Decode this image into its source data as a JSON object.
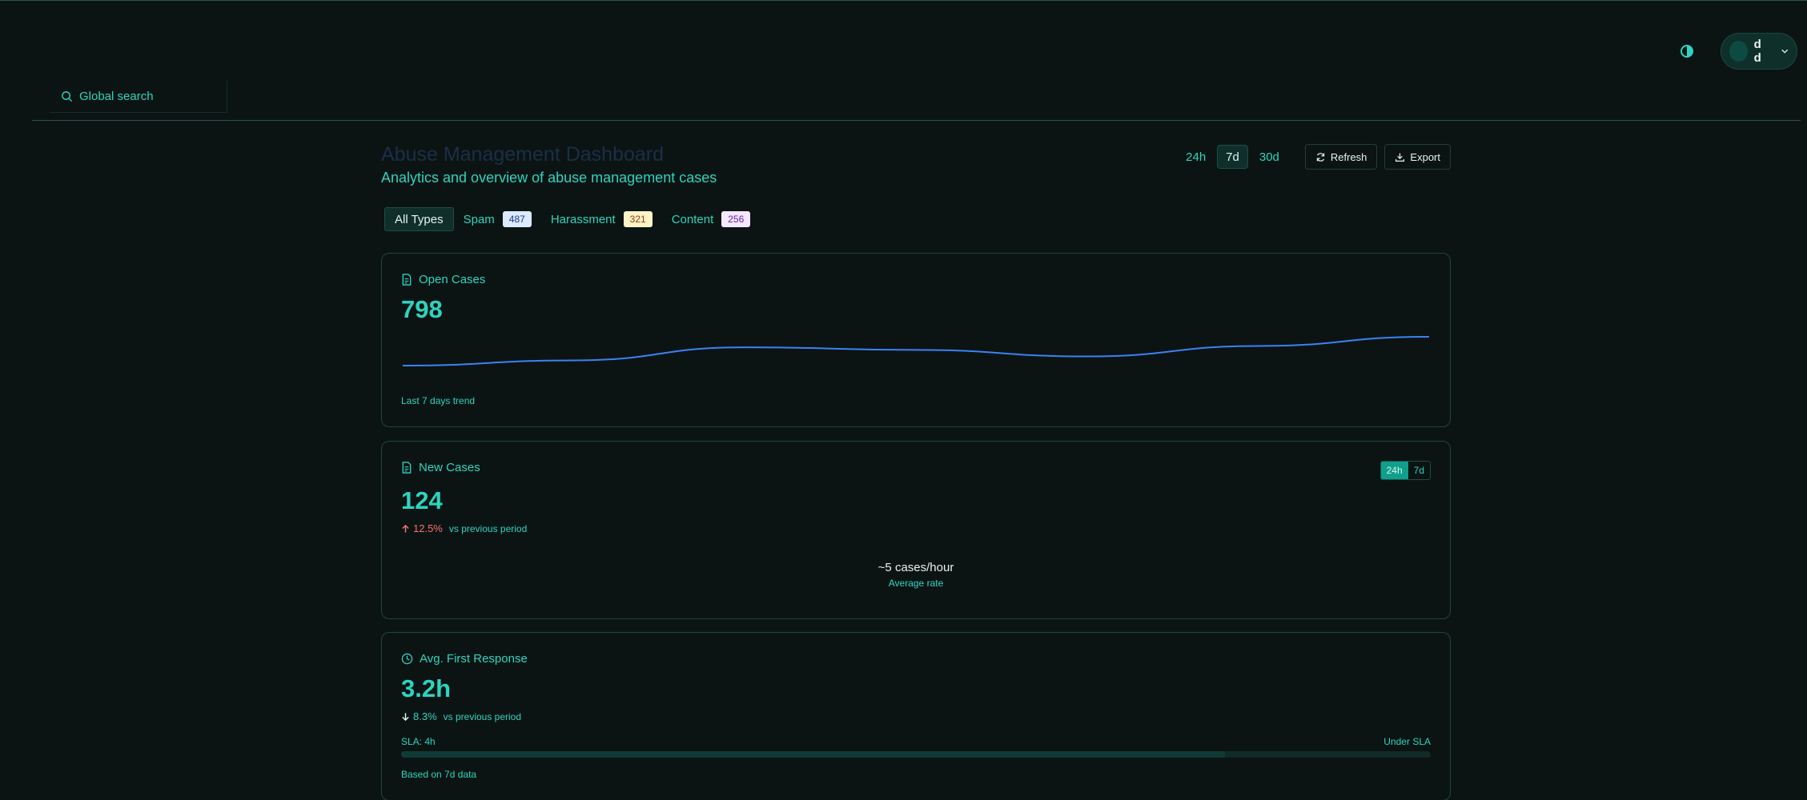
{
  "header": {
    "user_name": "d d",
    "search_placeholder": "Global search"
  },
  "page": {
    "title": "Abuse Management Dashboard",
    "subtitle": "Analytics and overview of abuse management cases"
  },
  "periods": [
    "24h",
    "7d",
    "30d"
  ],
  "active_period": "7d",
  "actions": {
    "refresh": "Refresh",
    "export": "Export"
  },
  "filters": {
    "all": "All Types",
    "items": [
      {
        "label": "Spam",
        "count": "487"
      },
      {
        "label": "Harassment",
        "count": "321"
      },
      {
        "label": "Content",
        "count": "256"
      }
    ]
  },
  "open_cases": {
    "title": "Open Cases",
    "value": "798",
    "footnote": "Last 7 days trend",
    "trend": [
      776,
      780,
      790,
      788,
      783,
      791,
      798
    ]
  },
  "new_cases": {
    "title": "New Cases",
    "value": "124",
    "toggle": [
      "24h",
      "7d"
    ],
    "toggle_active": "24h",
    "change": "12.5%",
    "change_note": "vs previous period",
    "rate": "~5 cases/hour",
    "rate_label": "Average rate"
  },
  "first_response": {
    "title": "Avg. First Response",
    "value": "3.2h",
    "change": "8.3%",
    "change_note": "vs previous period",
    "sla_label": "SLA: 4h",
    "sla_status": "Under SLA",
    "sla_fraction": 0.8,
    "footnote": "Based on 7d data"
  },
  "colors": {
    "accent": "#2dd4bf",
    "trend_line": "#3b82f6",
    "negative": "#f87171",
    "background": "#0b1413"
  }
}
